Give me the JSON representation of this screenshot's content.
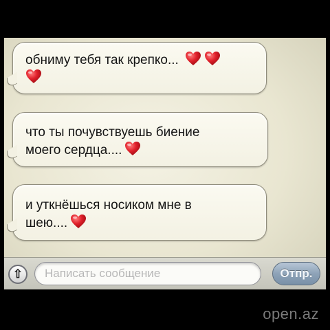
{
  "messages": [
    {
      "text": "обниму тебя так крепко...",
      "hearts_inline": 2,
      "hearts_next_line": 1
    },
    {
      "text_line1": "что ты почувствуешь биение",
      "text_line2": "моего сердца....",
      "hearts": 1
    },
    {
      "text_line1": "и уткнёшься носиком мне в",
      "text_line2": "шею....",
      "hearts": 1
    }
  ],
  "input_bar": {
    "placeholder": "Написать сообщение",
    "send_label": "Отпр.",
    "attach_icon": "arrow-up-icon"
  },
  "watermark": "open.az",
  "colors": {
    "heart": "#e0202a",
    "bubble": "#f6f4e8",
    "send_button": "#8ea3b8"
  }
}
